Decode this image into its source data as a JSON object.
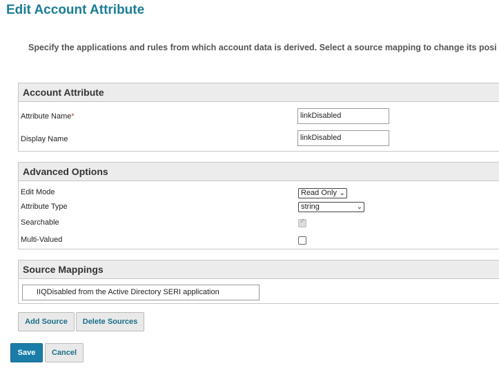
{
  "page": {
    "title": "Edit Account Attribute",
    "instructions": "Specify the applications and rules from which account data is derived. Select a source mapping to change its posi"
  },
  "account_attribute": {
    "header": "Account Attribute",
    "attribute_name_label": "Attribute Name",
    "required_marker": "*",
    "attribute_name_value": "linkDisabled",
    "display_name_label": "Display Name",
    "display_name_value": "linkDisabled"
  },
  "advanced_options": {
    "header": "Advanced Options",
    "edit_mode_label": "Edit Mode",
    "edit_mode_value": "Read Only",
    "attribute_type_label": "Attribute Type",
    "attribute_type_value": "string",
    "searchable_label": "Searchable",
    "searchable_checked": true,
    "multi_valued_label": "Multi-Valued",
    "multi_valued_checked": false
  },
  "source_mappings": {
    "header": "Source Mappings",
    "items": [
      "IIQDisabled from the Active Directory SERI application"
    ]
  },
  "buttons": {
    "add_source": "Add Source",
    "delete_sources": "Delete Sources",
    "save": "Save",
    "cancel": "Cancel"
  },
  "icons": {
    "select_caret": "chevron-down-icon",
    "checkmark": "check-icon"
  }
}
